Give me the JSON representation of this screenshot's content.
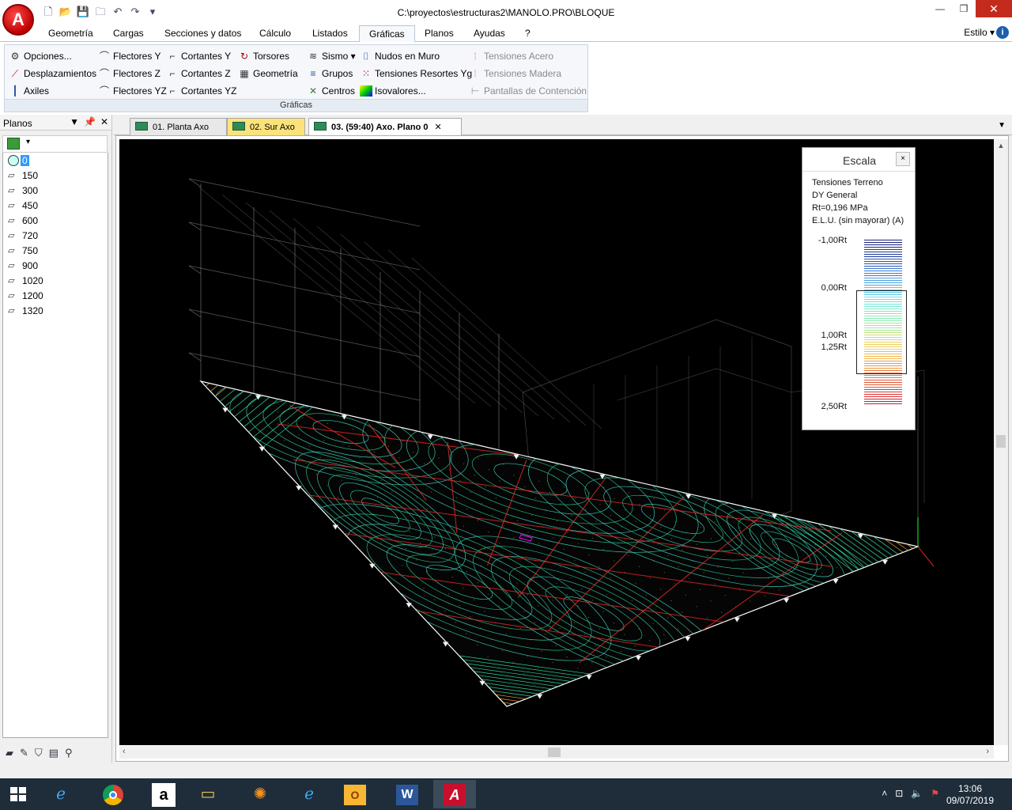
{
  "window": {
    "title": "C:\\proyectos\\estructuras2\\MANOLO.PRO\\BLOQUE",
    "logo_letter": "A"
  },
  "menu": {
    "tabs": [
      "Geometría",
      "Cargas",
      "Secciones y datos",
      "Cálculo",
      "Listados",
      "Gráficas",
      "Planos",
      "Ayudas",
      "?"
    ],
    "active_tab": "Gráficas",
    "estilo": "Estilo",
    "help": "i"
  },
  "ribbon": {
    "group_label": "Gráficas",
    "buttons": {
      "opciones": "Opciones...",
      "desplazamientos": "Desplazamientos",
      "axiles": "Axiles",
      "flectores_y": "Flectores Y",
      "flectores_z": "Flectores Z",
      "flectores_yz": "Flectores YZ",
      "cortantes_y": "Cortantes Y",
      "cortantes_z": "Cortantes Z",
      "cortantes_yz": "Cortantes YZ",
      "torsores": "Torsores",
      "geometria": "Geometría",
      "sismo": "Sismo",
      "grupos": "Grupos",
      "centros": "Centros",
      "nudos_muro": "Nudos en Muro",
      "tensiones_resortes": "Tensiones Resortes Yg",
      "isovalores": "Isovalores...",
      "tensiones_acero": "Tensiones Acero",
      "tensiones_madera": "Tensiones Madera",
      "pantallas": "Pantallas de Contención"
    }
  },
  "planos": {
    "title": "Planos",
    "items": [
      "0",
      "150",
      "300",
      "450",
      "600",
      "720",
      "750",
      "900",
      "1020",
      "1200",
      "1320"
    ],
    "selected": "0"
  },
  "doc_tabs": [
    {
      "label": "01. Planta   Axo"
    },
    {
      "label": "02. Sur   Axo"
    },
    {
      "label": "03.  (59:40)  Axo. Plano 0"
    }
  ],
  "escala": {
    "title": "Escala",
    "close": "×",
    "line1": "Tensiones Terreno",
    "line2": "DY General",
    "line3": "Rt=0,196   MPa",
    "line4": "E.L.U. (sin mayorar) (A)",
    "labels": [
      "-1,00Rt",
      "0,00Rt",
      "1,00Rt",
      "1,25Rt",
      "2,50Rt"
    ]
  },
  "taskbar": {
    "time": "13:06",
    "date": "09/07/2019"
  },
  "colors": {
    "accent_red": "#c00000",
    "viewport_bg": "#000000",
    "contour_green": "#2bd39a",
    "beam_red": "#ff2a2a",
    "wire_grey": "#8a8a8a"
  }
}
